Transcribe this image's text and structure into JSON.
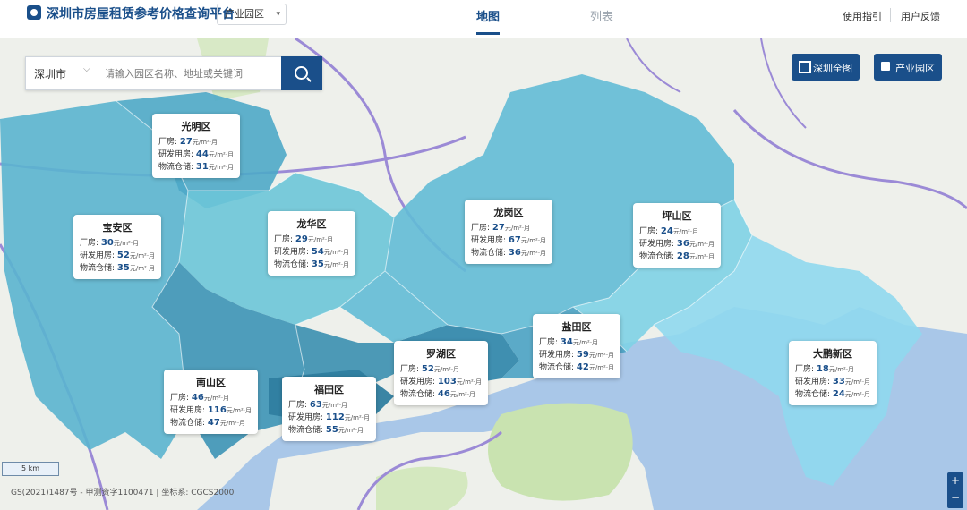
{
  "header": {
    "title": "深圳市房屋租赁参考价格查询平台",
    "category_select": "产业园区",
    "tabs": [
      {
        "label": "地图",
        "active": true
      },
      {
        "label": "列表",
        "active": false
      }
    ],
    "links": [
      "使用指引",
      "用户反馈"
    ]
  },
  "search": {
    "city": "深圳市",
    "placeholder": "请输入园区名称、地址或关键词"
  },
  "map_buttons": {
    "full_view": "深圳全图",
    "park_toggle": "产业园区"
  },
  "districts": [
    {
      "name": "光明区",
      "rows": [
        {
          "label": "厂房:",
          "value": "27"
        },
        {
          "label": "研发用房:",
          "value": "44"
        },
        {
          "label": "物流仓储:",
          "value": "31"
        }
      ]
    },
    {
      "name": "宝安区",
      "rows": [
        {
          "label": "厂房:",
          "value": "30"
        },
        {
          "label": "研发用房:",
          "value": "52"
        },
        {
          "label": "物流仓储:",
          "value": "35"
        }
      ]
    },
    {
      "name": "龙华区",
      "rows": [
        {
          "label": "厂房:",
          "value": "29"
        },
        {
          "label": "研发用房:",
          "value": "54"
        },
        {
          "label": "物流仓储:",
          "value": "35"
        }
      ]
    },
    {
      "name": "龙岗区",
      "rows": [
        {
          "label": "厂房:",
          "value": "27"
        },
        {
          "label": "研发用房:",
          "value": "67"
        },
        {
          "label": "物流仓储:",
          "value": "36"
        }
      ]
    },
    {
      "name": "坪山区",
      "rows": [
        {
          "label": "厂房:",
          "value": "24"
        },
        {
          "label": "研发用房:",
          "value": "36"
        },
        {
          "label": "物流仓储:",
          "value": "28"
        }
      ]
    },
    {
      "name": "盐田区",
      "rows": [
        {
          "label": "厂房:",
          "value": "34"
        },
        {
          "label": "研发用房:",
          "value": "59"
        },
        {
          "label": "物流仓储:",
          "value": "42"
        }
      ]
    },
    {
      "name": "罗湖区",
      "rows": [
        {
          "label": "厂房:",
          "value": "52"
        },
        {
          "label": "研发用房:",
          "value": "103"
        },
        {
          "label": "物流仓储:",
          "value": "46"
        }
      ]
    },
    {
      "name": "南山区",
      "rows": [
        {
          "label": "厂房:",
          "value": "46"
        },
        {
          "label": "研发用房:",
          "value": "116"
        },
        {
          "label": "物流仓储:",
          "value": "47"
        }
      ]
    },
    {
      "name": "福田区",
      "rows": [
        {
          "label": "厂房:",
          "value": "63"
        },
        {
          "label": "研发用房:",
          "value": "112"
        },
        {
          "label": "物流仓储:",
          "value": "55"
        }
      ]
    },
    {
      "name": "大鹏新区",
      "rows": [
        {
          "label": "厂房:",
          "value": "18"
        },
        {
          "label": "研发用房:",
          "value": "33"
        },
        {
          "label": "物流仓储:",
          "value": "24"
        }
      ]
    }
  ],
  "unit": "元/m²·月",
  "map": {
    "scale_label": "5 km",
    "attribution": "GS(2021)1487号 - 甲测资字1100471 | 坐标系: CGCS2000",
    "zoom_in": "+",
    "zoom_out": "−",
    "colors": {
      "water": "#a9c7e8",
      "land": "#eef0eb",
      "highway": "#9b8ad6",
      "district_light": "#8fd8ee",
      "district_dark": "#2f7ea0"
    }
  }
}
